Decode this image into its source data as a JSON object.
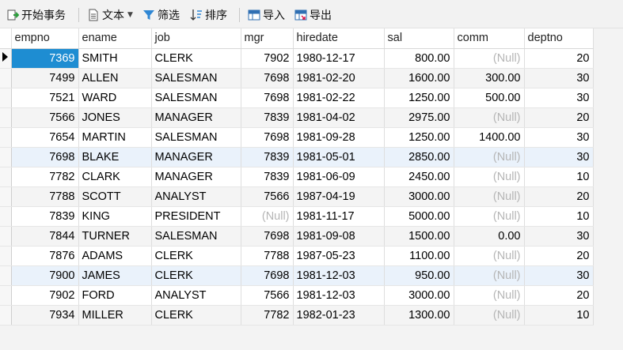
{
  "toolbar": {
    "begin_tx": "开始事务",
    "text": "文本",
    "filter": "筛选",
    "sort": "排序",
    "import": "导入",
    "export": "导出"
  },
  "columns": [
    "empno",
    "ename",
    "job",
    "mgr",
    "hiredate",
    "sal",
    "comm",
    "deptno"
  ],
  "rows": [
    [
      "7369",
      "SMITH",
      "CLERK",
      "7902",
      "1980-12-17",
      "800.00",
      "(Null)",
      "20"
    ],
    [
      "7499",
      "ALLEN",
      "SALESMAN",
      "7698",
      "1981-02-20",
      "1600.00",
      "300.00",
      "30"
    ],
    [
      "7521",
      "WARD",
      "SALESMAN",
      "7698",
      "1981-02-22",
      "1250.00",
      "500.00",
      "30"
    ],
    [
      "7566",
      "JONES",
      "MANAGER",
      "7839",
      "1981-04-02",
      "2975.00",
      "(Null)",
      "20"
    ],
    [
      "7654",
      "MARTIN",
      "SALESMAN",
      "7698",
      "1981-09-28",
      "1250.00",
      "1400.00",
      "30"
    ],
    [
      "7698",
      "BLAKE",
      "MANAGER",
      "7839",
      "1981-05-01",
      "2850.00",
      "(Null)",
      "30"
    ],
    [
      "7782",
      "CLARK",
      "MANAGER",
      "7839",
      "1981-06-09",
      "2450.00",
      "(Null)",
      "10"
    ],
    [
      "7788",
      "SCOTT",
      "ANALYST",
      "7566",
      "1987-04-19",
      "3000.00",
      "(Null)",
      "20"
    ],
    [
      "7839",
      "KING",
      "PRESIDENT",
      "(Null)",
      "1981-11-17",
      "5000.00",
      "(Null)",
      "10"
    ],
    [
      "7844",
      "TURNER",
      "SALESMAN",
      "7698",
      "1981-09-08",
      "1500.00",
      "0.00",
      "30"
    ],
    [
      "7876",
      "ADAMS",
      "CLERK",
      "7788",
      "1987-05-23",
      "1100.00",
      "(Null)",
      "20"
    ],
    [
      "7900",
      "JAMES",
      "CLERK",
      "7698",
      "1981-12-03",
      "950.00",
      "(Null)",
      "30"
    ],
    [
      "7902",
      "FORD",
      "ANALYST",
      "7566",
      "1981-12-03",
      "3000.00",
      "(Null)",
      "20"
    ],
    [
      "7934",
      "MILLER",
      "CLERK",
      "7782",
      "1982-01-23",
      "1300.00",
      "(Null)",
      "10"
    ]
  ],
  "numeric_columns": [
    0,
    3,
    5,
    6,
    7
  ],
  "current_row": 0,
  "highlighted_rows": [
    5,
    11
  ],
  "colors": {
    "selected_cell": "#1e8dd2",
    "null_text": "#b5b5b5",
    "highlight_row": "#eaf2fb"
  }
}
